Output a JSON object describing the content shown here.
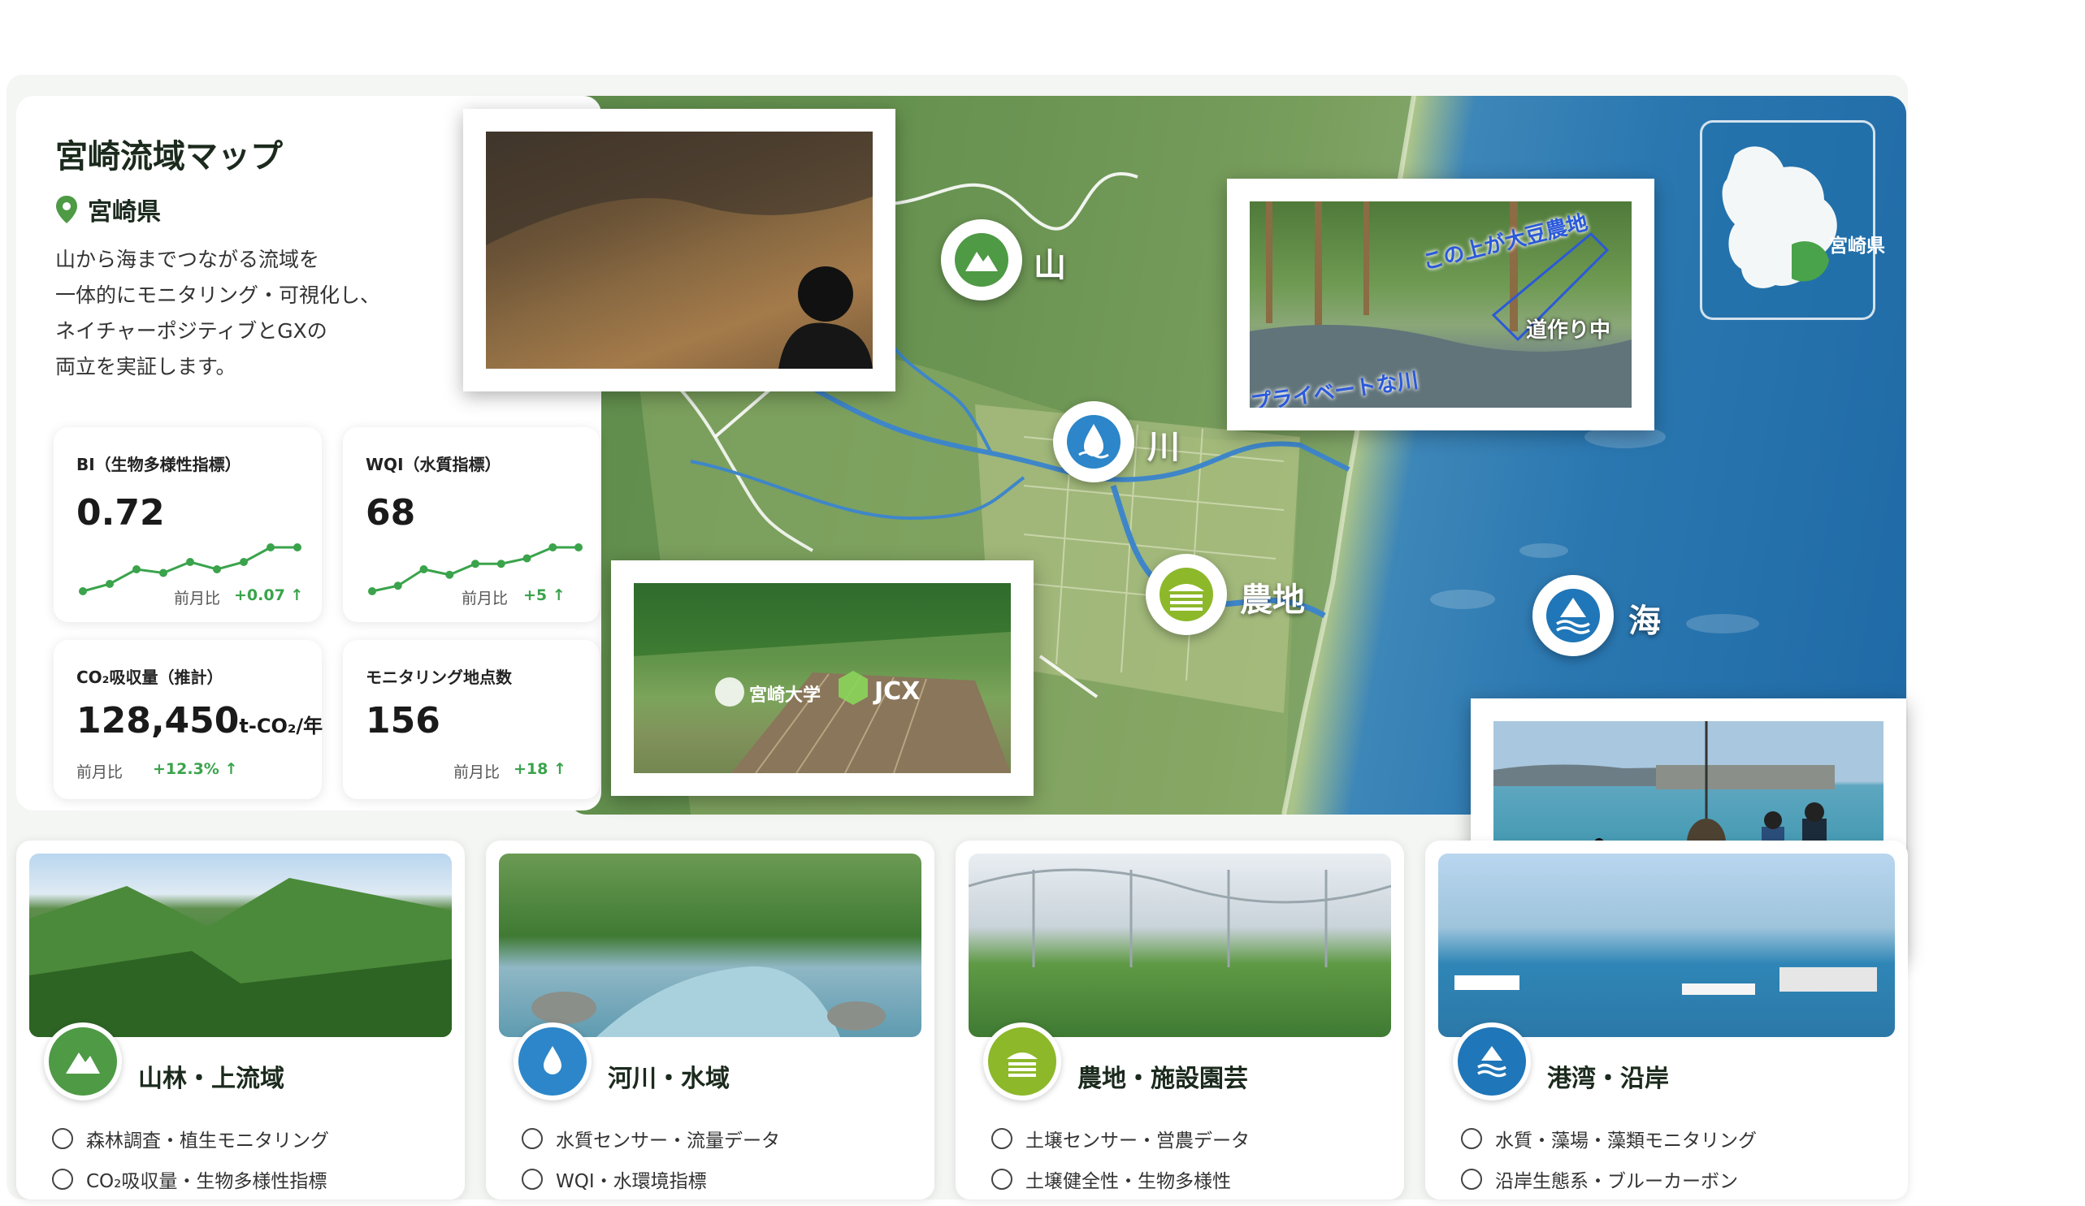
{
  "info": {
    "title": "宮崎流域マップ",
    "location": "宮崎県",
    "description": [
      "山から海までつながる流域を",
      "一体的にモニタリング・可視化し、",
      "ネイチャーポジティブとGXの",
      "両立を実証します。"
    ]
  },
  "metrics": {
    "bi": {
      "label": "BI（生物多様性指標）",
      "value": "0.72",
      "compare_label": "前月比",
      "change": "+0.07 ↑"
    },
    "wqi": {
      "label": "WQI（水質指標）",
      "value": "68",
      "compare_label": "前月比",
      "change": "+5 ↑"
    },
    "co2": {
      "label": "CO₂吸収量（推計）",
      "value": "128,450",
      "unit": "t-CO₂/年",
      "compare_label": "前月比",
      "change": "+12.3% ↑"
    },
    "points": {
      "label": "モニタリング地点数",
      "value": "156",
      "compare_label": "前月比",
      "change": "+18 ↑"
    }
  },
  "map": {
    "inset_label": "宮崎県",
    "markers": {
      "mountain": "山",
      "river": "川",
      "farm": "農地",
      "sea": "海"
    },
    "river_photo": {
      "text_top": "この上が大豆農地",
      "text_mid": "道作り中",
      "text_bottom": "プライベートな川"
    },
    "farm_photo": {
      "logo_a": "宮崎大学",
      "logo_b": "JCX"
    }
  },
  "categories": [
    {
      "title": "山林・上流域",
      "items": [
        "森林調査・植生モニタリング",
        "CO₂吸収量・生物多様性指標"
      ],
      "color": "#4e9a45"
    },
    {
      "title": "河川・水域",
      "items": [
        "水質センサー・流量データ",
        "WQI・水環境指標"
      ],
      "color": "#2c86c9"
    },
    {
      "title": "農地・施設園芸",
      "items": [
        "土壌センサー・営農データ",
        "土壌健全性・生物多様性"
      ],
      "color": "#8cb82a"
    },
    {
      "title": "港湾・沿岸",
      "items": [
        "水質・藻場・藻類モニタリング",
        "沿岸生態系・ブルーカーボン"
      ],
      "color": "#1f76b8"
    }
  ],
  "colors": {
    "accent_green": "#3aa34b",
    "sea_blue": "#2a77b0"
  },
  "sparklines": {
    "bi": [
      0.6,
      0.62,
      0.66,
      0.65,
      0.68,
      0.66,
      0.68,
      0.72,
      0.72
    ],
    "wqi": [
      60,
      61,
      64,
      63,
      65,
      65,
      66,
      68,
      68
    ]
  }
}
